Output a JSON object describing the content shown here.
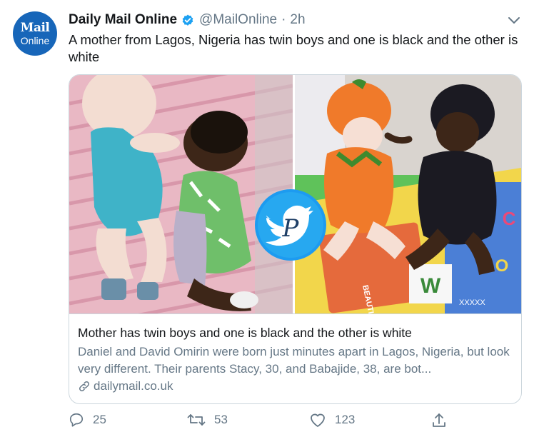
{
  "account": {
    "avatar_line1": "Mail",
    "avatar_line2": "Online",
    "display_name": "Daily Mail Online",
    "handle": "@MailOnline",
    "separator": "·",
    "time": "2h"
  },
  "tweet": {
    "text": "A mother from Lagos, Nigeria has twin boys and one is black and the other is white"
  },
  "card": {
    "title": "Mother has twin boys and one is black and the other is white",
    "description": "Daniel and David Omirin were born just minutes apart in Lagos, Nigeria, but look very different. Their parents Stacy, 30, and Babajide, 38, are bot...",
    "domain": "dailymail.co.uk",
    "mat_letters": [
      "W",
      "C",
      "O",
      "BEAUTIFUL",
      "XXXXX"
    ]
  },
  "actions": {
    "replies": "25",
    "retweets": "53",
    "likes": "123"
  },
  "colors": {
    "brand": "#1766b9",
    "verified": "#1da1f2",
    "muted": "#657786",
    "border": "#ccd6dd"
  },
  "icons": [
    "verified-badge-icon",
    "chevron-down-icon",
    "link-icon",
    "reply-icon",
    "retweet-icon",
    "like-icon",
    "share-icon",
    "watermark-bird-icon"
  ]
}
